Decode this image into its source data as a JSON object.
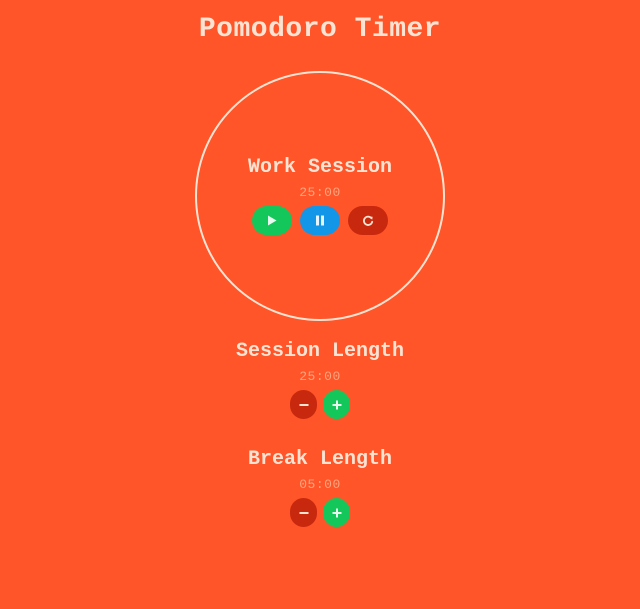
{
  "app": {
    "title": "Pomodoro Timer"
  },
  "timer": {
    "session_label": "Work Session",
    "time": "25:00",
    "controls": {
      "play_icon": "play-icon",
      "pause_icon": "pause-icon",
      "reset_icon": "refresh-icon"
    }
  },
  "session_length": {
    "label": "Session Length",
    "value": "25:00",
    "decrement_icon": "minus-icon",
    "increment_icon": "plus-icon"
  },
  "break_length": {
    "label": "Break Length",
    "value": "05:00",
    "decrement_icon": "minus-icon",
    "increment_icon": "plus-icon"
  },
  "colors": {
    "background": "#FF5528",
    "text": "#FBE3D3",
    "time_text": "#FFA57F",
    "play": "#14C75A",
    "pause": "#1296E8",
    "reset": "#C8290E"
  }
}
